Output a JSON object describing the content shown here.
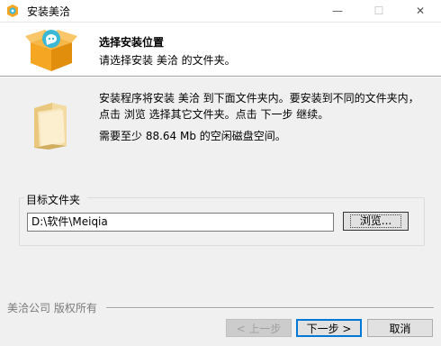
{
  "window": {
    "title": "安装美洽",
    "minimize_glyph": "—",
    "maximize_glyph": "☐",
    "close_glyph": "✕"
  },
  "header": {
    "title": "选择安装位置",
    "subtitle": "请选择安装 美洽 的文件夹。"
  },
  "body": {
    "description_line1": "安装程序将安装 美洽 到下面文件夹内。要安装到不同的文件夹内，",
    "description_line2": "点击 浏览 选择其它文件夹。点击 下一步 继续。",
    "space_required": "需要至少 88.64 Mb 的空闲磁盘空间。"
  },
  "destination": {
    "group_label": "目标文件夹",
    "path_value": "D:\\软件\\Meiqia",
    "browse_label": "浏览..."
  },
  "footer": {
    "brand_text": "美洽公司 版权所有",
    "back_label": "< 上一步",
    "next_label": "下一步 >",
    "cancel_label": "取消"
  },
  "colors": {
    "accent": "#0078d7",
    "box_orange": "#f5a623",
    "folder_yellow": "#f1d9a0"
  }
}
